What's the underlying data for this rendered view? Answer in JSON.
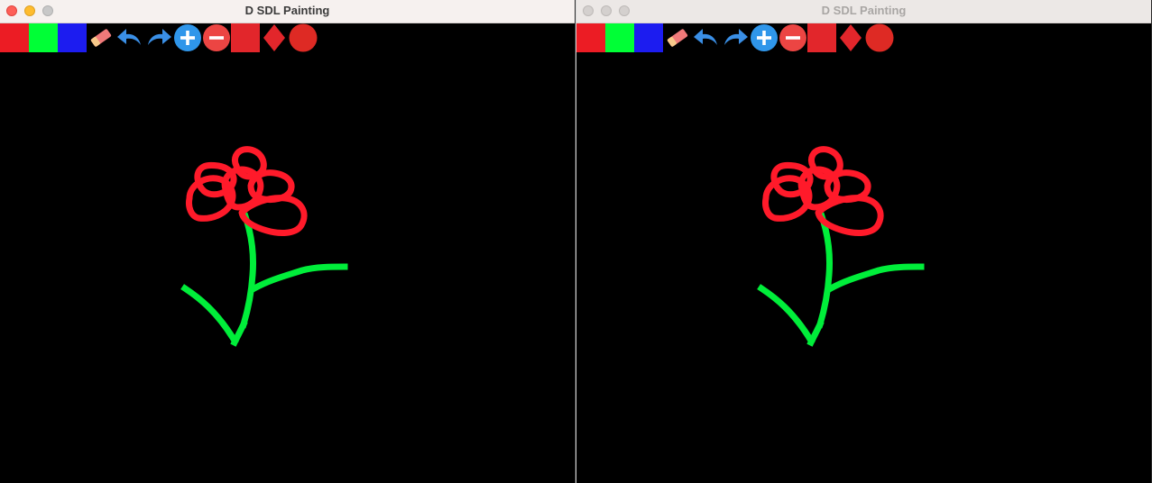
{
  "windows": [
    {
      "id": "left",
      "title": "D SDL Painting",
      "focused": true
    },
    {
      "id": "right",
      "title": "D SDL Painting",
      "focused": false
    }
  ],
  "toolbar": {
    "tools": [
      {
        "name": "color-red",
        "color": "#ec1c24",
        "icon": "square"
      },
      {
        "name": "color-green",
        "color": "#00ff36",
        "icon": "square"
      },
      {
        "name": "color-blue",
        "color": "#1c1cf0",
        "icon": "square"
      },
      {
        "name": "eraser",
        "icon": "eraser-icon"
      },
      {
        "name": "undo",
        "icon": "undo-arrow-icon"
      },
      {
        "name": "redo",
        "icon": "redo-arrow-icon"
      },
      {
        "name": "increase-size",
        "icon": "plus-circle-icon"
      },
      {
        "name": "decrease-size",
        "icon": "minus-circle-icon"
      },
      {
        "name": "shape-square",
        "icon": "square-icon"
      },
      {
        "name": "shape-diamond",
        "icon": "diamond-icon"
      },
      {
        "name": "shape-circle",
        "icon": "circle-icon"
      }
    ]
  },
  "drawing": {
    "petal_color": "#ff1a2a",
    "stem_color": "#00ee3a"
  }
}
